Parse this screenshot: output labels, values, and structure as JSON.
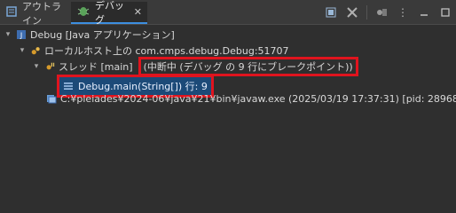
{
  "tabs": [
    {
      "label": "アウトライン",
      "active": false
    },
    {
      "label": "デバッグ",
      "active": true
    }
  ],
  "tree": {
    "launch": "Debug [Java アプリケーション]",
    "vm": "ローカルホスト上の com.cmps.debug.Debug:51707",
    "thread": "スレッド [main]",
    "thread_status": "(中断中 (デバッグ の 9 行にブレークポイント))",
    "frame": "Debug.main(String[]) 行: 9",
    "process": "C:¥pleiades¥2024-06¥java¥21¥bin¥javaw.exe (2025/03/19 17:37:31) [pid: 28968]"
  },
  "colors": {
    "highlight_border": "#e0141e",
    "selection_bg": "#1c4a78",
    "active_tab_underline": "#3d8ee0"
  }
}
